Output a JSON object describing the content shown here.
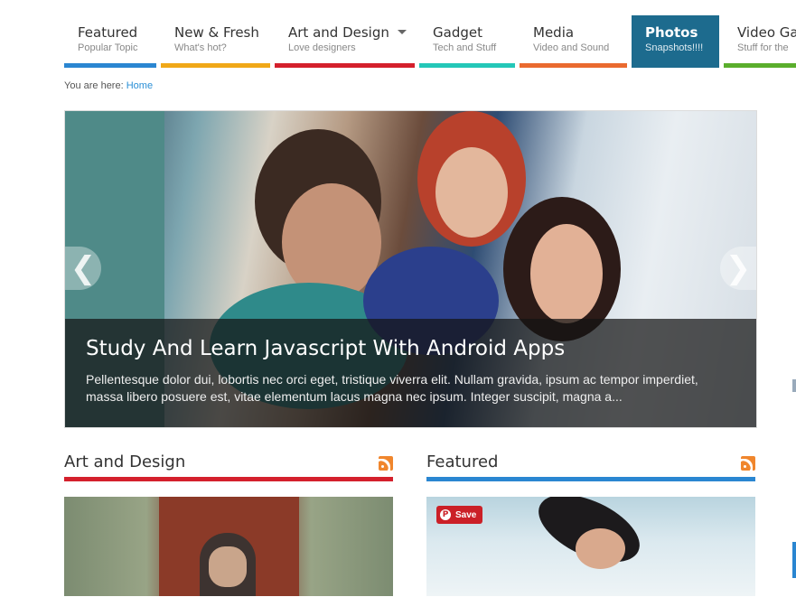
{
  "nav": {
    "items": [
      {
        "title": "Featured",
        "sub": "Popular Topic",
        "color": "#2a86d1"
      },
      {
        "title": "New & Fresh",
        "sub": "What's hot?",
        "color": "#f0a818"
      },
      {
        "title": "Art and Design",
        "sub": "Love designers",
        "color": "#d4202c"
      },
      {
        "title": "Gadget",
        "sub": "Tech and Stuff",
        "color": "#24c7b8"
      },
      {
        "title": "Media",
        "sub": "Video and Sound",
        "color": "#ea6a2f"
      },
      {
        "title": "Photos",
        "sub": "Snapshots!!!!",
        "color": "#1d6b8e"
      },
      {
        "title": "Video Ga",
        "sub": "Stuff for the",
        "color": "#5aae2c"
      }
    ]
  },
  "breadcrumb": {
    "prefix": "You are here:",
    "home": "Home"
  },
  "slider": {
    "title": "Study And Learn Javascript With Android Apps",
    "excerpt": "Pellentesque dolor dui, lobortis nec orci eget, tristique viverra elit. Nullam gravida, ipsum ac tempor imperdiet, massa libero posuere est, vitae elementum lacus magna nec ipsum. Integer suscipit, magna a...",
    "prev_icon": "chevron-left-icon",
    "next_icon": "chevron-right-icon"
  },
  "sections": [
    {
      "title": "Art and Design",
      "color": "#d4202c",
      "icon": "rss-icon"
    },
    {
      "title": "Featured",
      "color": "#2a86d1",
      "icon": "rss-icon",
      "pin_label": "Save"
    }
  ]
}
